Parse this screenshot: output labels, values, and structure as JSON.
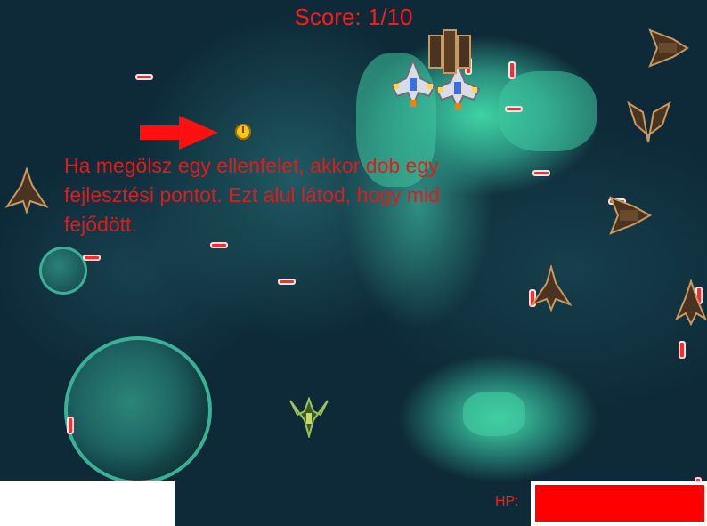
{
  "hud": {
    "score_text": "Score: 1/10",
    "hp_label": "HP:",
    "hp_fraction": 1.0
  },
  "tutorial": {
    "text": "Ha megölsz egy ellenfelet, akkor dob egy fejlesztési pontot. Ezt alul látod, hogy mid fejődött."
  },
  "colors": {
    "hud_text": "#ff1a1a",
    "tutorial_text": "#e01b1b",
    "hp_bar": "#ff0000",
    "bullet": "#ff2b2b",
    "upgrade_coin": "#f5c518"
  },
  "icons": {
    "pointer": "arrow-right-icon",
    "upgrade": "upgrade-coin-icon",
    "player": "player-ship-icon",
    "enemy_fighter": "enemy-fighter-icon",
    "enemy_heavy": "enemy-heavy-ship-icon"
  }
}
